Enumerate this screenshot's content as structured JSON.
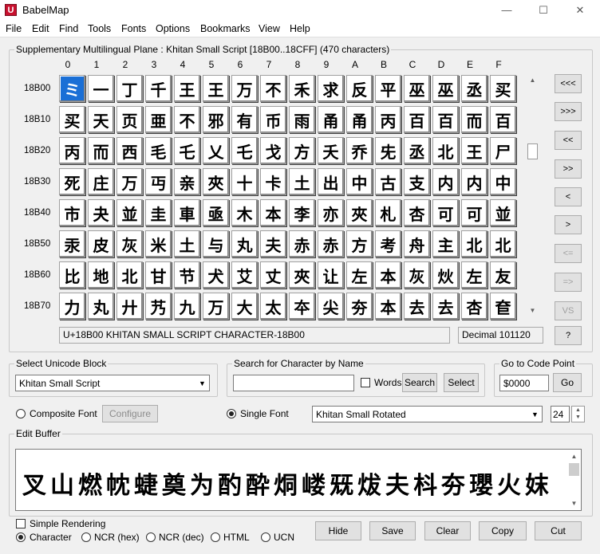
{
  "window": {
    "title": "BabelMap",
    "app_icon_letter": "U"
  },
  "menu": [
    "File",
    "Edit",
    "Find",
    "Tools",
    "Fonts",
    "Options",
    "Bookmarks",
    "View",
    "Help"
  ],
  "plane_group": {
    "label": "Supplementary Multilingual Plane : Khitan Small Script [18B00..18CFF] (470 characters)"
  },
  "col_headers": [
    "0",
    "1",
    "2",
    "3",
    "4",
    "5",
    "6",
    "7",
    "8",
    "9",
    "A",
    "B",
    "C",
    "D",
    "E",
    "F"
  ],
  "rows": [
    {
      "label": "18B00",
      "chars": [
        "ミ",
        "一",
        "丁",
        "千",
        "王",
        "王",
        "万",
        "不",
        "禾",
        "求",
        "反",
        "平",
        "巫",
        "巫",
        "丞",
        "买"
      ]
    },
    {
      "label": "18B10",
      "chars": [
        "买",
        "天",
        "页",
        "亜",
        "不",
        "邪",
        "有",
        "币",
        "雨",
        "甬",
        "甬",
        "丙",
        "百",
        "百",
        "而",
        "百"
      ]
    },
    {
      "label": "18B20",
      "chars": [
        "丙",
        "而",
        "西",
        "毛",
        "乇",
        "乂",
        "乇",
        "戈",
        "方",
        "夭",
        "乔",
        "兂",
        "丞",
        "北",
        "王",
        "尸"
      ]
    },
    {
      "label": "18B30",
      "chars": [
        "死",
        "庄",
        "万",
        "丏",
        "亲",
        "夾",
        "十",
        "卡",
        "土",
        "出",
        "中",
        "古",
        "支",
        "内",
        "内",
        "中"
      ]
    },
    {
      "label": "18B40",
      "chars": [
        "市",
        "夬",
        "並",
        "圭",
        "車",
        "亟",
        "木",
        "本",
        "李",
        "亦",
        "夾",
        "札",
        "杏",
        "可",
        "可",
        "並"
      ]
    },
    {
      "label": "18B50",
      "chars": [
        "汞",
        "皮",
        "灰",
        "米",
        "土",
        "与",
        "丸",
        "夫",
        "赤",
        "赤",
        "方",
        "考",
        "舟",
        "主",
        "北",
        "北"
      ]
    },
    {
      "label": "18B60",
      "chars": [
        "比",
        "地",
        "北",
        "甘",
        "节",
        "犬",
        "艾",
        "丈",
        "夾",
        "让",
        "左",
        "本",
        "灰",
        "炏",
        "左",
        "友"
      ]
    },
    {
      "label": "18B70",
      "chars": [
        "力",
        "丸",
        "廾",
        "艿",
        "九",
        "万",
        "大",
        "太",
        "夲",
        "尖",
        "夯",
        "本",
        "去",
        "去",
        "杏",
        "奆"
      ]
    }
  ],
  "nav_buttons": [
    "<<<",
    ">>>",
    "<<",
    ">>",
    "<",
    ">",
    "<=",
    "=>",
    "VS",
    "?"
  ],
  "status": {
    "char_name": "U+18B00 KHITAN SMALL SCRIPT CHARACTER-18B00",
    "decimal": "Decimal 101120"
  },
  "unicode_block": {
    "label": "Select Unicode Block",
    "value": "Khitan Small Script"
  },
  "search": {
    "label": "Search for Character by Name",
    "value": "",
    "words_label": "Words",
    "search_button": "Search",
    "select_button": "Select"
  },
  "goto": {
    "label": "Go to Code Point",
    "value": "$0000",
    "go_button": "Go"
  },
  "font_options": {
    "composite_label": "Composite Font",
    "configure_button": "Configure",
    "single_label": "Single Font",
    "selected": "single",
    "font_name": "Khitan Small Rotated",
    "font_size": "24"
  },
  "edit_buffer": {
    "label": "Edit Buffer",
    "text": "叉山燃帎蜨奠为酌酔烔嵝兓炦夫枓夯瓔火妺"
  },
  "bottom": {
    "simple_rendering_label": "Simple Rendering",
    "formats": [
      "Character",
      "NCR (hex)",
      "NCR (dec)",
      "HTML",
      "UCN"
    ],
    "selected_format": "Character",
    "buttons": [
      "Hide",
      "Save",
      "Clear",
      "Copy",
      "Cut"
    ]
  }
}
